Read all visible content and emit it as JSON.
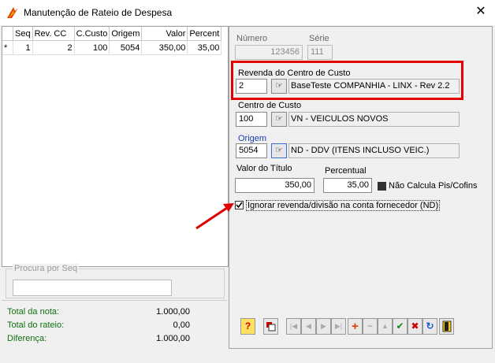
{
  "window": {
    "title": "Manutenção de Rateio de Despesa",
    "close_glyph": "✕"
  },
  "grid": {
    "headers": [
      "Seq",
      "Rev. CC",
      "C.Custo",
      "Origem",
      "Valor",
      "Percent"
    ],
    "rows": [
      {
        "marker": "*",
        "seq": "1",
        "rev_cc": "2",
        "c_custo": "100",
        "origem": "5054",
        "valor": "350,00",
        "percent": "35,00"
      }
    ]
  },
  "search": {
    "label": "Procura por Seq",
    "value": ""
  },
  "totals": {
    "nota_label": "Total da nota:",
    "nota_value": "1.000,00",
    "rateio_label": "Total do rateio:",
    "rateio_value": "0,00",
    "diferenca_label": "Diferença:",
    "diferenca_value": "1.000,00"
  },
  "form": {
    "numero_label": "Número",
    "numero_value": "123456",
    "serie_label": "Série",
    "serie_value": "111",
    "revenda_label": "Revenda do Centro de Custo",
    "revenda_value": "2",
    "revenda_desc": "BaseTeste COMPANHIA - LINX - Rev 2.2",
    "centro_label": "Centro de Custo",
    "centro_value": "100",
    "centro_desc": "VN - VEICULOS NOVOS",
    "origem_label": "Origem",
    "origem_value": "5054",
    "origem_desc": "ND - DDV (ITENS INCLUSO VEIC.)",
    "valor_label": "Valor do Título",
    "valor_value": "350,00",
    "percentual_label": "Percentual",
    "percentual_value": "35,00",
    "pis_label": "Não Calcula Pis/Cofins",
    "ignorar_label": "Ignorar revenda/divisão na conta fornecedor (ND)"
  },
  "toolbar": {
    "help": "?",
    "first": "|◀",
    "prev": "◀",
    "next": "▶",
    "last": "▶|",
    "insert": "+",
    "delete": "−",
    "edit": "▲",
    "post": "✔",
    "cancel": "✖",
    "refresh": "↻"
  },
  "colors": {
    "highlight": "#e00000",
    "total_label": "#107010",
    "origem_label": "#1a3fb0"
  }
}
